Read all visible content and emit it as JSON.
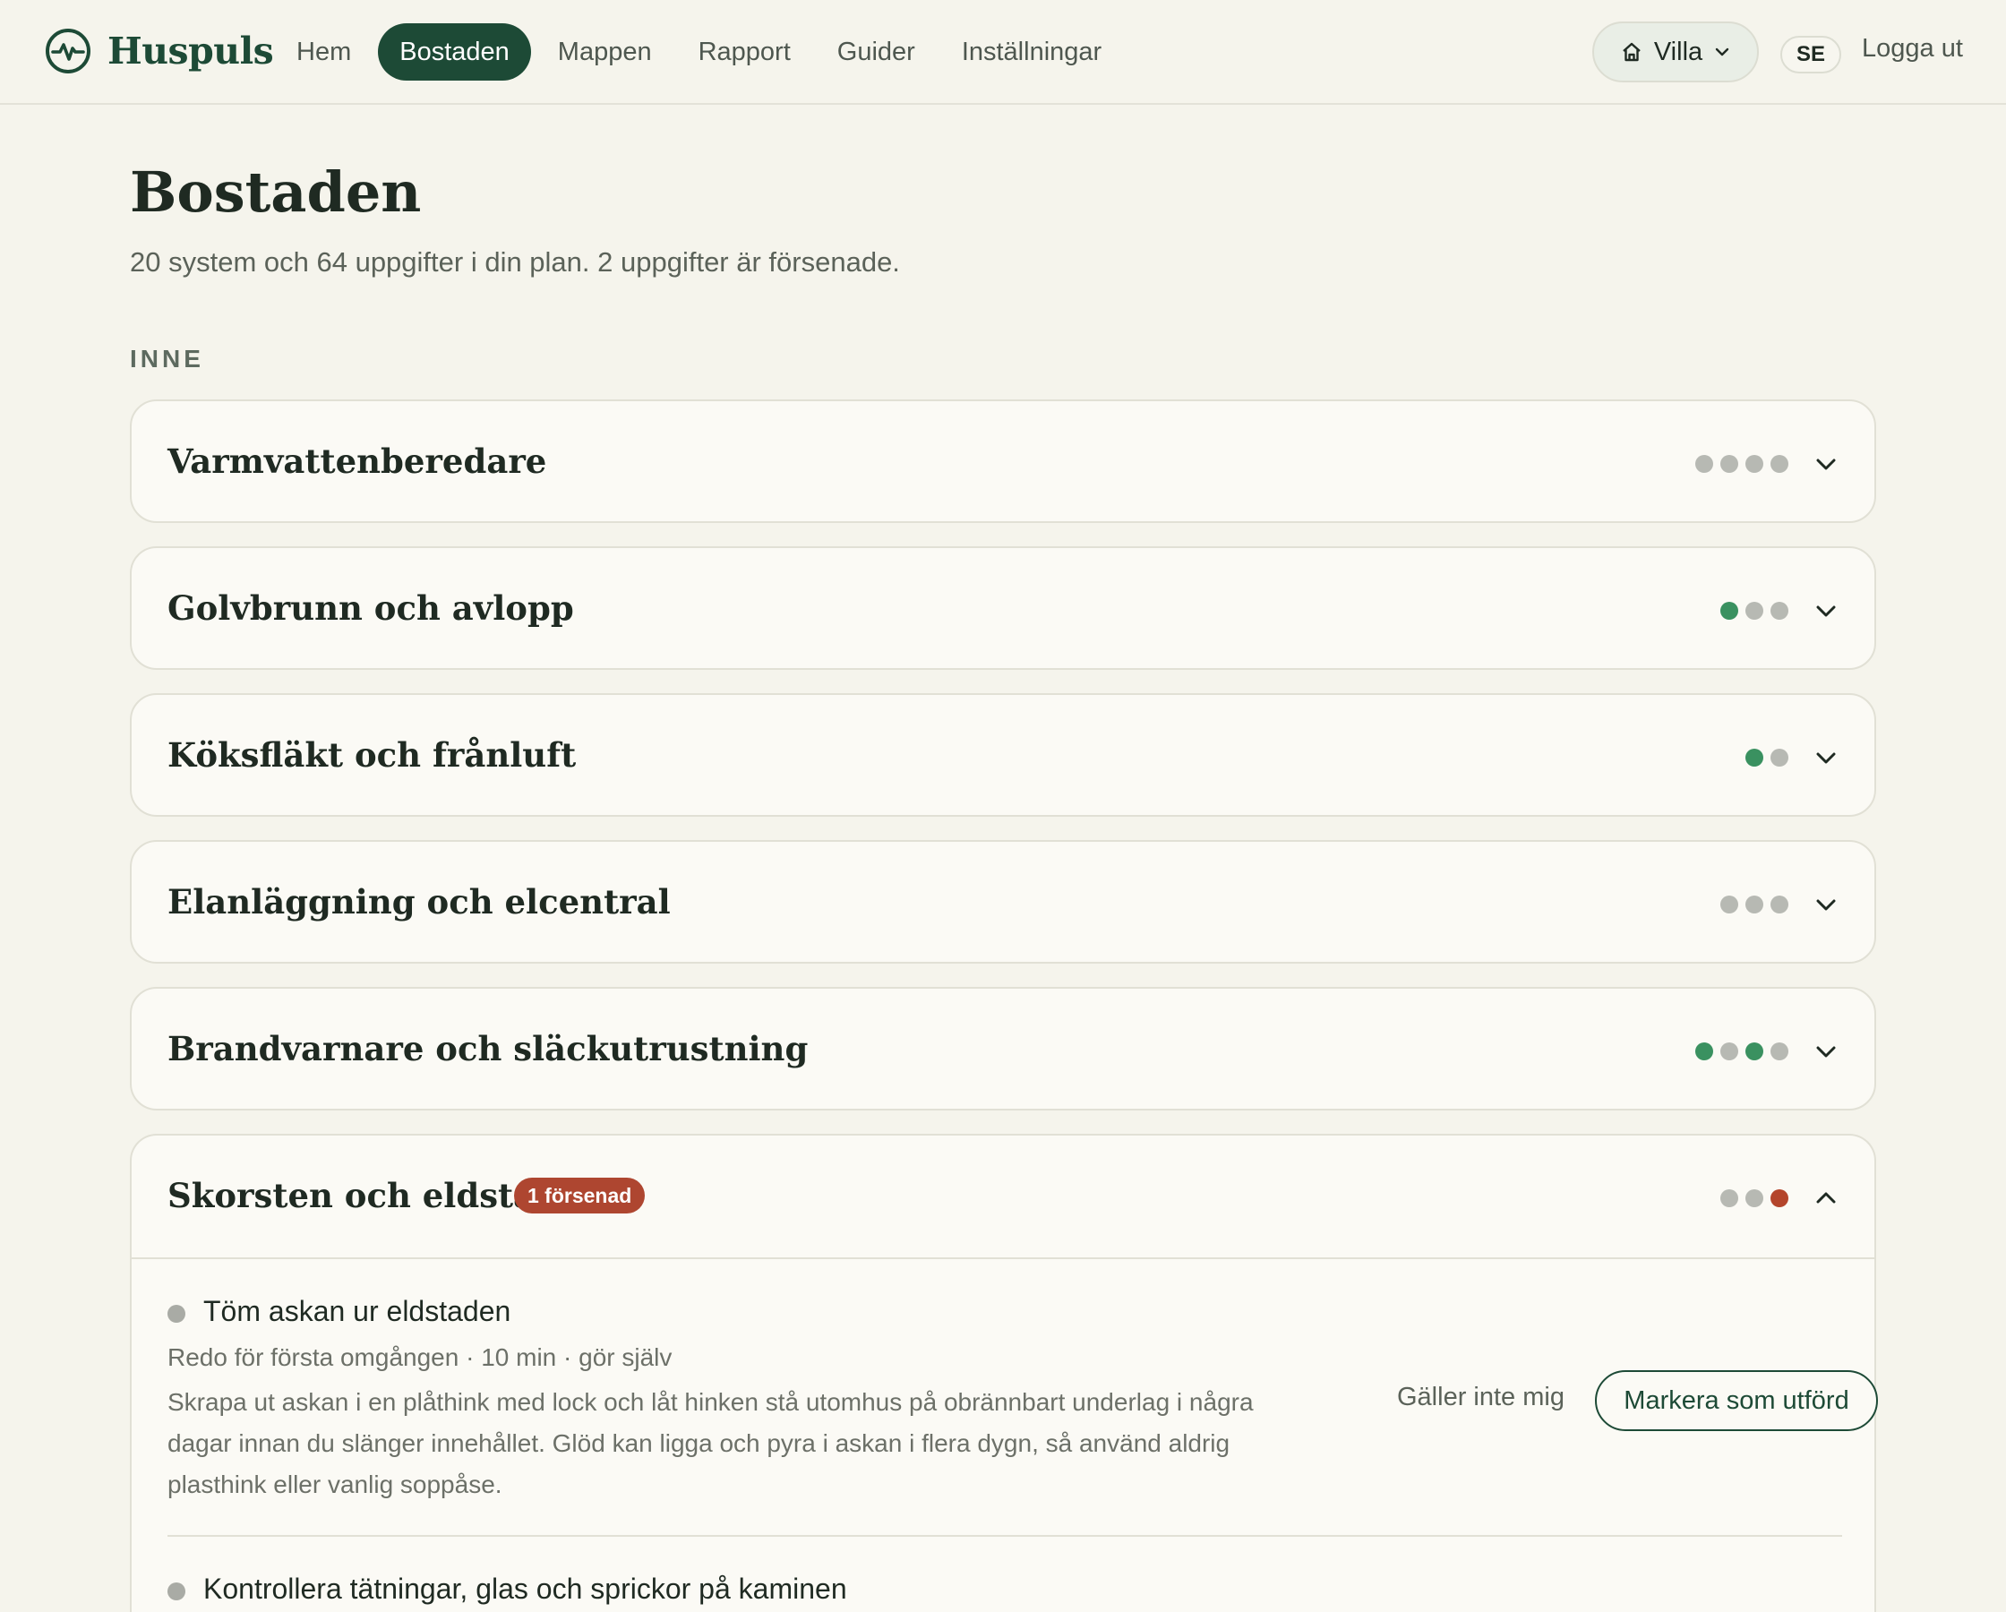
{
  "header": {
    "brand": "Huspuls",
    "nav": [
      "Hem",
      "Bostaden",
      "Mappen",
      "Rapport",
      "Guider",
      "Inställningar"
    ],
    "active_nav": "Bostaden",
    "property_select": "Villa",
    "language": "SE",
    "logout": "Logga ut"
  },
  "page": {
    "title": "Bostaden",
    "subtitle": "20 system och 64 uppgifter i din plan. 2 uppgifter är försenade.",
    "section": "INNE"
  },
  "systems": [
    {
      "name": "Varmvattenberedare",
      "dots": [
        "grey",
        "grey",
        "grey",
        "grey"
      ]
    },
    {
      "name": "Golvbrunn och avlopp",
      "dots": [
        "green",
        "grey",
        "grey"
      ]
    },
    {
      "name": "Köksfläkt och frånluft",
      "dots": [
        "green",
        "grey"
      ]
    },
    {
      "name": "Elanläggning och elcentral",
      "dots": [
        "grey",
        "grey",
        "grey"
      ]
    },
    {
      "name": "Brandvarnare och släckutrustning",
      "dots": [
        "green",
        "grey",
        "green",
        "grey"
      ]
    },
    {
      "name": "Skorsten och eldstad",
      "badge": "1 försenad",
      "dots": [
        "grey",
        "grey",
        "red"
      ],
      "expanded": true
    }
  ],
  "expanded_tasks": [
    {
      "title": "Töm askan ur eldstaden",
      "meta": "Redo för första omgången · 10 min · gör själv",
      "description": "Skrapa ut askan i en plåthink med lock och låt hinken stå utomhus på obrännbart underlag i några dagar innan du slänger innehållet. Glöd kan ligga och pyra i askan i flera dygn, så använd aldrig plasthink eller vanlig soppåse.",
      "not_applicable": "Gäller inte mig",
      "mark_done": "Markera som utförd"
    },
    {
      "title": "Kontrollera tätningar, glas och sprickor på kaminen"
    }
  ],
  "colors": {
    "brand": "#1d4a36",
    "background": "#f5f4ec",
    "dot_green": "#3a9160",
    "dot_grey": "#b7b9b3",
    "dot_red": "#b4452b",
    "badge": "#ae4630"
  }
}
